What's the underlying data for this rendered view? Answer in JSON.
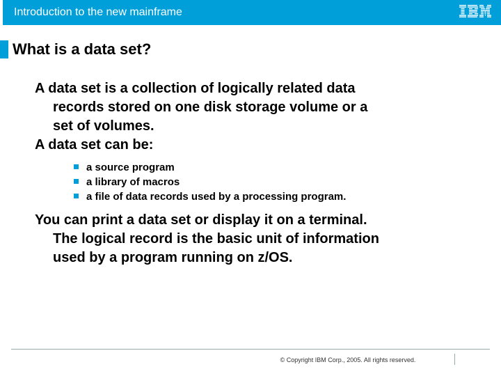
{
  "header": {
    "title": "Introduction to the new mainframe",
    "logo_name": "ibm-logo"
  },
  "slide": {
    "title": "What is a data set?",
    "para1_line1": "A data set is a collection of logically related data",
    "para1_line2": "records stored on one disk storage volume or a",
    "para1_line3": "set of volumes.",
    "para2": "A data set can be:",
    "bullets": [
      "a source program",
      "a library of macros",
      "a file of data records used by a processing program."
    ],
    "para3_line1": "You can print a data set or display it on a terminal.",
    "para3_line2": "The logical record is the basic unit of information",
    "para3_line3": "used by a program running on z/OS."
  },
  "footer": {
    "copyright": "© Copyright IBM Corp., 2005. All rights reserved."
  },
  "colors": {
    "accent": "#009fda"
  }
}
